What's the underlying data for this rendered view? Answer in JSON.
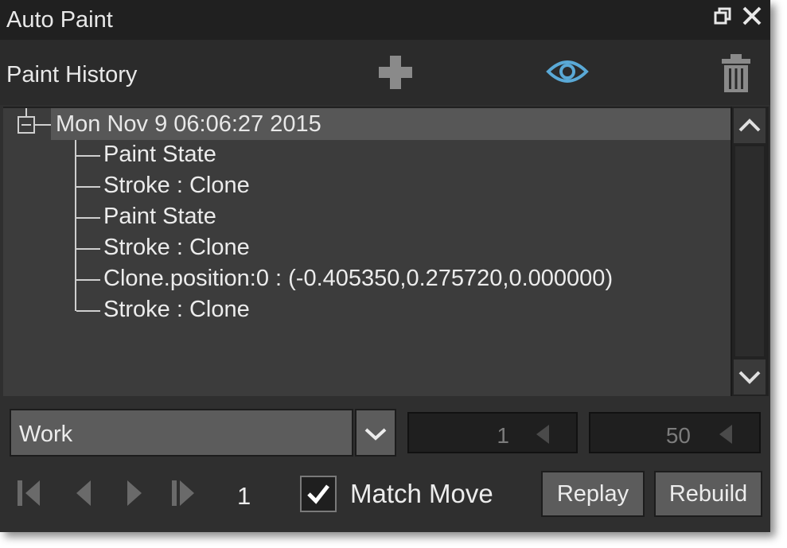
{
  "window": {
    "title": "Auto Paint",
    "float_icon": "restore-icon",
    "close_icon": "close-icon"
  },
  "header": {
    "label": "Paint History",
    "add_icon": "plus-icon",
    "eye_icon": "eye-icon",
    "trash_icon": "trash-icon"
  },
  "tree": {
    "root": "Mon Nov 9 06:06:27 2015",
    "children": [
      "Paint State",
      "Stroke : Clone",
      "Paint State",
      "Stroke : Clone",
      "Clone.position:0 : (-0.405350,0.275720,0.000000)",
      "Stroke : Clone"
    ]
  },
  "controls": {
    "mode": "Work",
    "start_frame": "1",
    "end_frame": "50",
    "current_frame": "1",
    "match_move_label": "Match Move",
    "match_move_checked": true,
    "replay_label": "Replay",
    "rebuild_label": "Rebuild"
  },
  "colors": {
    "panel_bg": "#2f2f2f",
    "tree_bg": "#3c3c3c",
    "selected_row": "#575757",
    "accent_blue": "#5aa9d6"
  }
}
